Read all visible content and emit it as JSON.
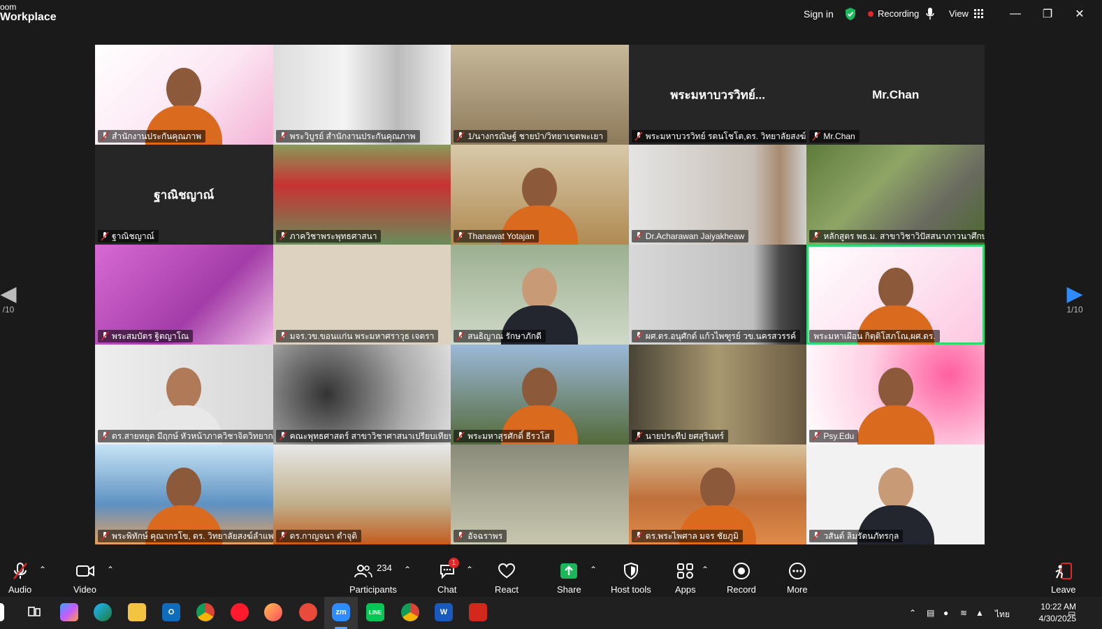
{
  "window": {
    "app_title_line1": "oom",
    "app_title_line2": "Workplace",
    "sign_in": "Sign in",
    "recording": "Recording",
    "view": "View"
  },
  "colors": {
    "active_speaker_border": "#2fd872",
    "recording_dot": "#e02828",
    "share_green": "#1bb75a",
    "nav_arrow_blue": "#2d8cff"
  },
  "pagination": {
    "left": "/10",
    "right": "1/10"
  },
  "participants": [
    "สำนักงานประกันคุณภาพ",
    "พระวิบูรย์ สำนักงานประกันคุณภาพ",
    "1/นางกรณิษฐ์ ชายป่า/วิทยาเขตพะเยา",
    "พระมหาบวรวิทย์ รตนโชโต,ดร. วิทยาลัยสงฆ์น...",
    "Mr.Chan",
    "ฐาณิชญาณ์",
    "ภาควิชาพระพุทธศาสนา",
    "Thanawat Yotajan",
    "Dr.Acharawan Jaiyakheaw",
    "หลักสูตร พธ.ม. สาขาวิชาวิปัสสนาภาวนาศึกษา",
    "พระสมบัตร ฐิตญาโณ",
    "มจร.วข.ขอนแก่น พระมหาศราวุธ เจตรา",
    "สนธิญาณ รักษาภักดี",
    "ผศ.ดร.อนุศักด์ แก้วไพฑูรย์ วข.นครสวรรค์",
    "พระมหาเผือน กิตฺติโสภโณ,ผศ.ดร.",
    "ดร.สายหยุด มีฤกษ์ หัวหน้าภาควิชาจิตวิทยาก...",
    "คณะพุทธศาสตร์ สาขาวิชาศาสนาเปรียบเทียบ...",
    "พระมหาสุรศักดิ์ ธีรวโส",
    "นายประทีป  ยศสุรินทร์",
    "Psy.Edu",
    "พระพิทักษ์ คุณากรโข, ดร. วิทยาลัยสงฆ์ลำแพ...",
    "ดร.กาญจนา  ดำจุติ",
    "อัจฉราพร",
    "ดร.พระไพศาล มจร ชัยภูมิ",
    "วสันต์ ลิมรัตนภัทรกุล"
  ],
  "name_cards": [
    "พระมหาบวรวิทย์...",
    "Mr.Chan",
    "ฐาณิชญาณ์"
  ],
  "toolbar": {
    "audio": "Audio",
    "video": "Video",
    "participants": "Participants",
    "participants_count": "234",
    "chat": "Chat",
    "chat_badge": "1",
    "react": "React",
    "share": "Share",
    "host_tools": "Host tools",
    "apps": "Apps",
    "record": "Record",
    "more": "More",
    "leave": "Leave"
  },
  "taskbar": {
    "zoom_label": "zm",
    "line_label": "LINE",
    "outlook_label": "O",
    "word_label": "W",
    "lang": "ไทย",
    "time": "10:22 AM",
    "date": "4/30/2025"
  },
  "icons": {
    "shield": "shield-check-icon",
    "mic": "mic-icon",
    "view": "grid-icon",
    "mute": "muted-mic-icon"
  }
}
